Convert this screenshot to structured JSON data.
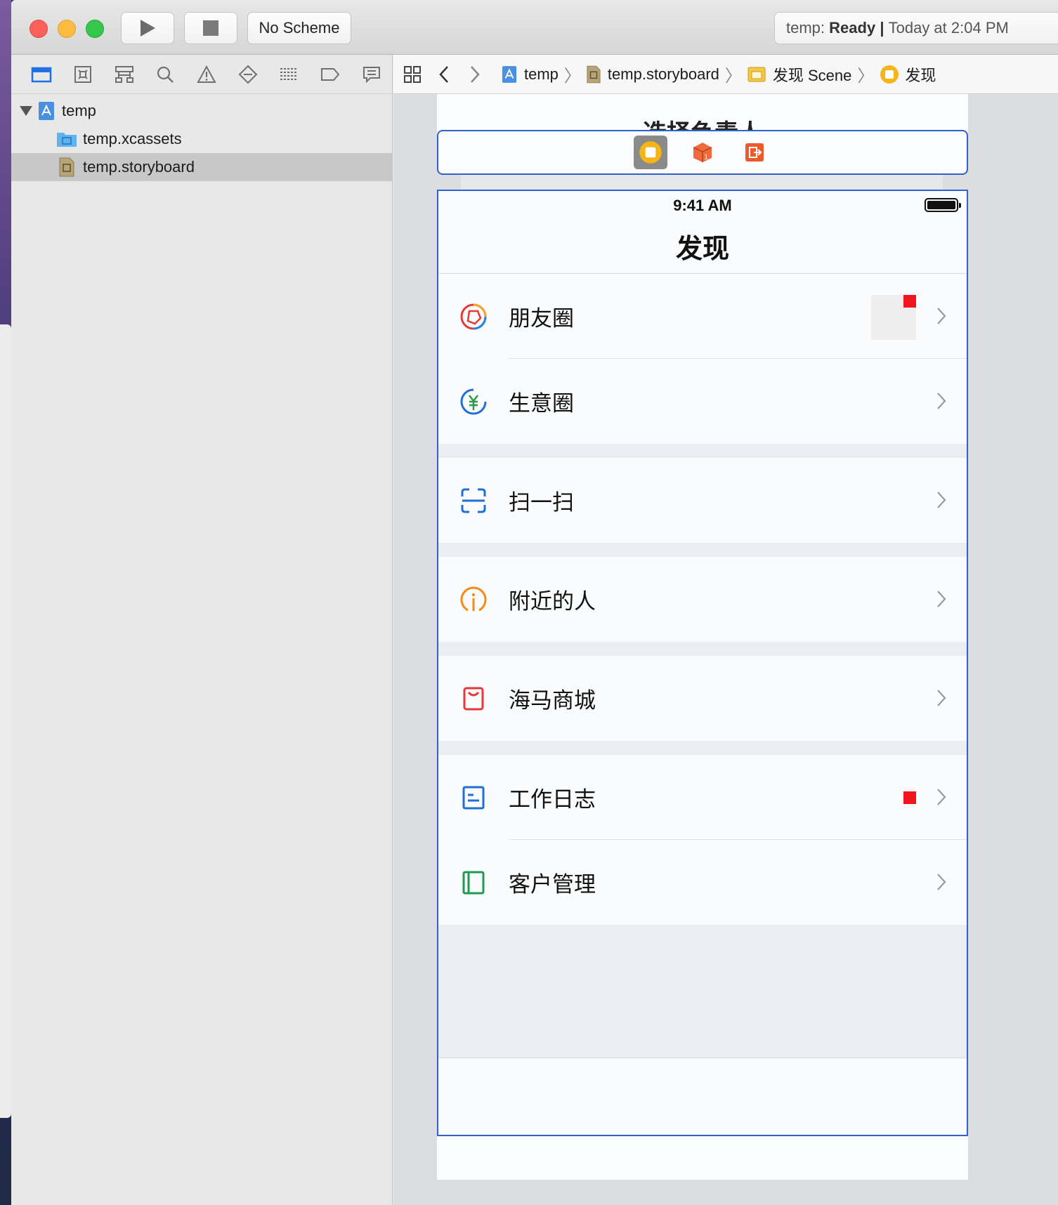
{
  "toolbar": {
    "scheme_label": "No Scheme",
    "status_project": "temp:",
    "status_state": "Ready",
    "status_separator": "|",
    "status_time": "Today at 2:04 PM"
  },
  "navigator": {
    "tabs": [
      "folder-icon",
      "source-control-icon",
      "hierarchy-icon",
      "find-icon",
      "issue-icon",
      "test-icon",
      "debug-icon",
      "breakpoint-icon",
      "report-icon"
    ],
    "tree": [
      {
        "label": "temp",
        "icon": "project-icon"
      },
      {
        "label": "temp.xcassets",
        "icon": "asset-catalog-icon"
      },
      {
        "label": "temp.storyboard",
        "icon": "storyboard-icon",
        "selected": true
      }
    ]
  },
  "jumpbar": {
    "items": [
      "temp",
      "temp.storyboard",
      "发现 Scene",
      "发现"
    ]
  },
  "canvas": {
    "previous_scene_title": "选择负责人",
    "dock_icons": [
      "view-controller-icon",
      "first-responder-icon",
      "exit-icon"
    ]
  },
  "phone": {
    "time": "9:41 AM",
    "nav_title": "发现",
    "sections": [
      [
        {
          "label": "朋友圈",
          "icon": "moments-icon",
          "badge": true,
          "thumbnail": true
        },
        {
          "label": "生意圈",
          "icon": "business-icon"
        }
      ],
      [
        {
          "label": "扫一扫",
          "icon": "scan-icon"
        }
      ],
      [
        {
          "label": "附近的人",
          "icon": "nearby-icon"
        }
      ],
      [
        {
          "label": "海马商城",
          "icon": "shop-icon"
        }
      ],
      [
        {
          "label": "工作日志",
          "icon": "worklog-icon",
          "badge": true
        },
        {
          "label": "客户管理",
          "icon": "customer-icon"
        }
      ]
    ]
  },
  "colors": {
    "selection_blue": "#2f63c9",
    "badge_red": "#f0141e",
    "accent_blue": "#1a73e8"
  }
}
